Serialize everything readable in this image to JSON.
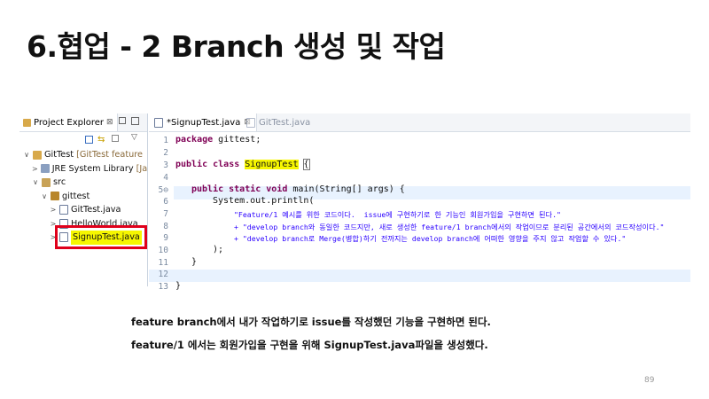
{
  "slide": {
    "title": "6.협업 - 2 Branch 생성 및 작업",
    "caption_line1": "feature branch에서 내가 작업하기로 issue를 작성했던 기능을 구현하면 된다.",
    "caption_line2": "feature/1 에서는 회원가입을 구현을 위해 SignupTest.java파일을 생성했다.",
    "page_number": "89"
  },
  "explorer": {
    "tab_label": "Project Explorer",
    "tab_close": "⊠",
    "tree": [
      {
        "label": "GitTest",
        "suffix": " [GitTest feature",
        "arrow": "∨",
        "icon": "project-icon"
      },
      {
        "label": "JRE System Library",
        "suffix": " [Jav",
        "arrow": ">",
        "icon": "library-icon"
      },
      {
        "label": "src",
        "suffix": "",
        "arrow": "∨",
        "icon": "source-folder-icon"
      },
      {
        "label": "gittest",
        "suffix": "",
        "arrow": "∨",
        "icon": "package-icon"
      },
      {
        "label": "GitTest.java",
        "suffix": "",
        "arrow": ">",
        "icon": "java-file-icon"
      },
      {
        "label": "HelloWorld.java",
        "suffix": "",
        "arrow": ">",
        "icon": "java-file-icon"
      },
      {
        "label": "SignupTest.java",
        "suffix": "",
        "arrow": ">",
        "icon": "java-file-icon"
      }
    ]
  },
  "editor": {
    "tabs": [
      {
        "label": "*SignupTest.java",
        "close": "⊠",
        "active": true
      },
      {
        "label": "GitTest.java",
        "close": "",
        "active": false
      }
    ],
    "line_numbers": [
      "1",
      "2",
      "3",
      "4",
      "5⊖",
      "6",
      "7",
      "8",
      "9",
      "10",
      "11",
      "12",
      "13"
    ],
    "code": {
      "l1_kw": "package",
      "l1_rest": " gittest;",
      "l3_kw": "public class",
      "l3_name": "SignupTest",
      "l3_brace": "{",
      "l5_kw": "public static void",
      "l5_rest": " main(String[] args) {",
      "l6": "System.out.println(",
      "l7": "\"Feature/1 예시를 위한 코드이다.  issue에 구현하기로 한 기능인 회원가입을 구현하면 된다.\"",
      "l8": "+ \"develop branch와 동일한 코드지만, 새로 생성한 feature/1 branch에서의 작업이므로 분리된 공간에서의 코드작성이다.\"",
      "l9": "+ \"develop branch로 Merge(병합)하기 전까지는 develop branch에 어떠한 영향을 주지 않고 작업할 수 있다.\"",
      "l10": ");",
      "l11": "}",
      "l13": "}"
    }
  }
}
